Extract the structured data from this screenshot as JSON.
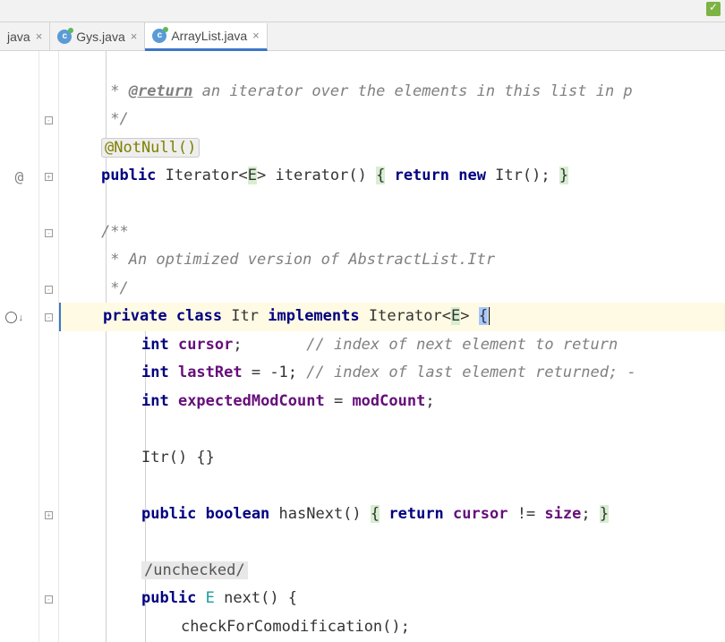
{
  "tabs": [
    {
      "label": "java",
      "icon": "",
      "active": false,
      "closeable": true
    },
    {
      "label": "Gys.java",
      "icon": "c",
      "active": false,
      "closeable": true
    },
    {
      "label": "ArrayList.java",
      "icon": "c",
      "active": true,
      "closeable": true
    }
  ],
  "gutter": {
    "at_text": "@",
    "override_icon": "o"
  },
  "code": {
    "l1_a": " * ",
    "l1_tag": "@return",
    "l1_b": " an iterator over the elements in this list in p",
    "l2": " */",
    "l3_annotation": "@NotNull()",
    "l4_kw1": "public",
    "l4_type": " Iterator<",
    "l4_param": "E",
    "l4_type2": "> iterator() ",
    "l4_brace1": "{",
    "l4_kw2": " return new ",
    "l4_call": "Itr(); ",
    "l4_brace2": "}",
    "l6": "/**",
    "l7": " * An optimized version of AbstractList.Itr",
    "l8": " */",
    "l9_kw1": "private class",
    "l9_name": " Itr ",
    "l9_kw2": "implements",
    "l9_type": " Iterator<",
    "l9_param": "E",
    "l9_type2": "> ",
    "l9_brace": "{",
    "l10_kw": "int",
    "l10_field": " cursor",
    "l10_rest": ";       ",
    "l10_comment": "// index of next element to return",
    "l11_kw": "int",
    "l11_field": " lastRet",
    "l11_rest": " = -1; ",
    "l11_comment": "// index of last element returned; -",
    "l12_kw": "int",
    "l12_field": " expectedModCount",
    "l12_rest": " = ",
    "l12_field2": "modCount",
    "l12_end": ";",
    "l14": "Itr() {}",
    "l16_kw1": "public boolean",
    "l16_name": " hasNext() ",
    "l16_brace1": "{",
    "l16_kw2": " return ",
    "l16_field": "cursor",
    "l16_op": " != ",
    "l16_field2": "size",
    "l16_end": "; ",
    "l16_brace2": "}",
    "l18_suppress": "/unchecked/",
    "l19_kw": "public",
    "l19_type": " E",
    "l19_name": " next() {",
    "l20": "checkForComodification();"
  }
}
